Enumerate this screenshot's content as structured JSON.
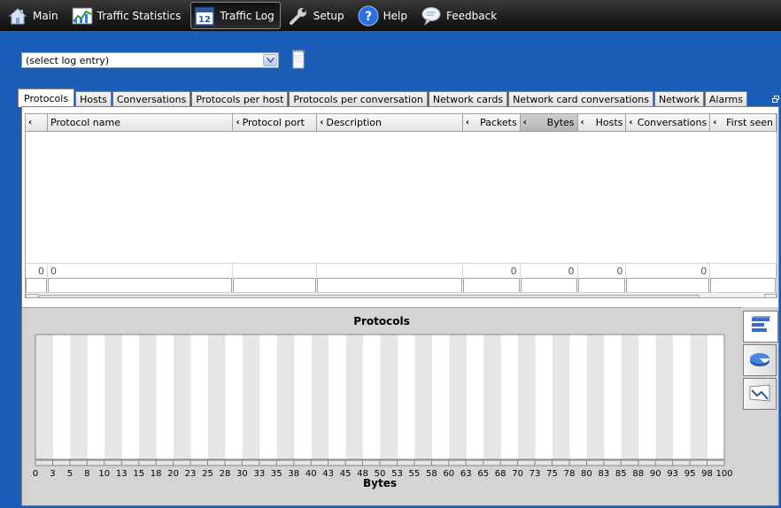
{
  "nav": {
    "items": [
      {
        "label": "Main",
        "icon": "house-icon"
      },
      {
        "label": "Traffic Statistics",
        "icon": "chart-icon"
      },
      {
        "label": "Traffic Log",
        "icon": "calendar-icon",
        "active": true
      },
      {
        "label": "Setup",
        "icon": "wrench-icon"
      },
      {
        "label": "Help",
        "icon": "help-icon"
      },
      {
        "label": "Feedback",
        "icon": "speech-bubble-icon"
      }
    ]
  },
  "log_select": {
    "value": "(select log entry)"
  },
  "tabs": [
    {
      "label": "Protocols",
      "active": true
    },
    {
      "label": "Hosts"
    },
    {
      "label": "Conversations"
    },
    {
      "label": "Protocols per host"
    },
    {
      "label": "Protocols per conversation"
    },
    {
      "label": "Network cards"
    },
    {
      "label": "Network card conversations"
    },
    {
      "label": "Network"
    },
    {
      "label": "Alarms"
    }
  ],
  "table": {
    "columns": [
      {
        "label": "Protocol name"
      },
      {
        "label": "Protocol port"
      },
      {
        "label": "Description"
      },
      {
        "label": "Packets"
      },
      {
        "label": "Bytes",
        "sorted": true
      },
      {
        "label": "Hosts"
      },
      {
        "label": "Conversations"
      },
      {
        "label": "First seen"
      }
    ],
    "summary": {
      "row_count": "0",
      "protocol_name": "0",
      "packets": "0",
      "bytes": "0",
      "hosts": "0",
      "conversations": "0"
    }
  },
  "chart": {
    "title": "Protocols",
    "xlabel": "Bytes"
  },
  "chart_data": {
    "type": "bar",
    "title": "Protocols",
    "xlabel": "Bytes",
    "ylabel": "",
    "xlim": [
      0,
      100
    ],
    "x_ticks": [
      "0",
      "3",
      "5",
      "8",
      "10",
      "13",
      "15",
      "18",
      "20",
      "23",
      "25",
      "28",
      "30",
      "33",
      "35",
      "38",
      "40",
      "43",
      "45",
      "48",
      "50",
      "53",
      "55",
      "58",
      "60",
      "63",
      "65",
      "68",
      "70",
      "73",
      "75",
      "78",
      "80",
      "83",
      "85",
      "88",
      "90",
      "93",
      "95",
      "98",
      "100"
    ],
    "categories": [],
    "values": []
  },
  "colors": {
    "background": "#1a5eb8",
    "navbar": "#1e1e1e",
    "stripe": "#e6e6e6"
  }
}
